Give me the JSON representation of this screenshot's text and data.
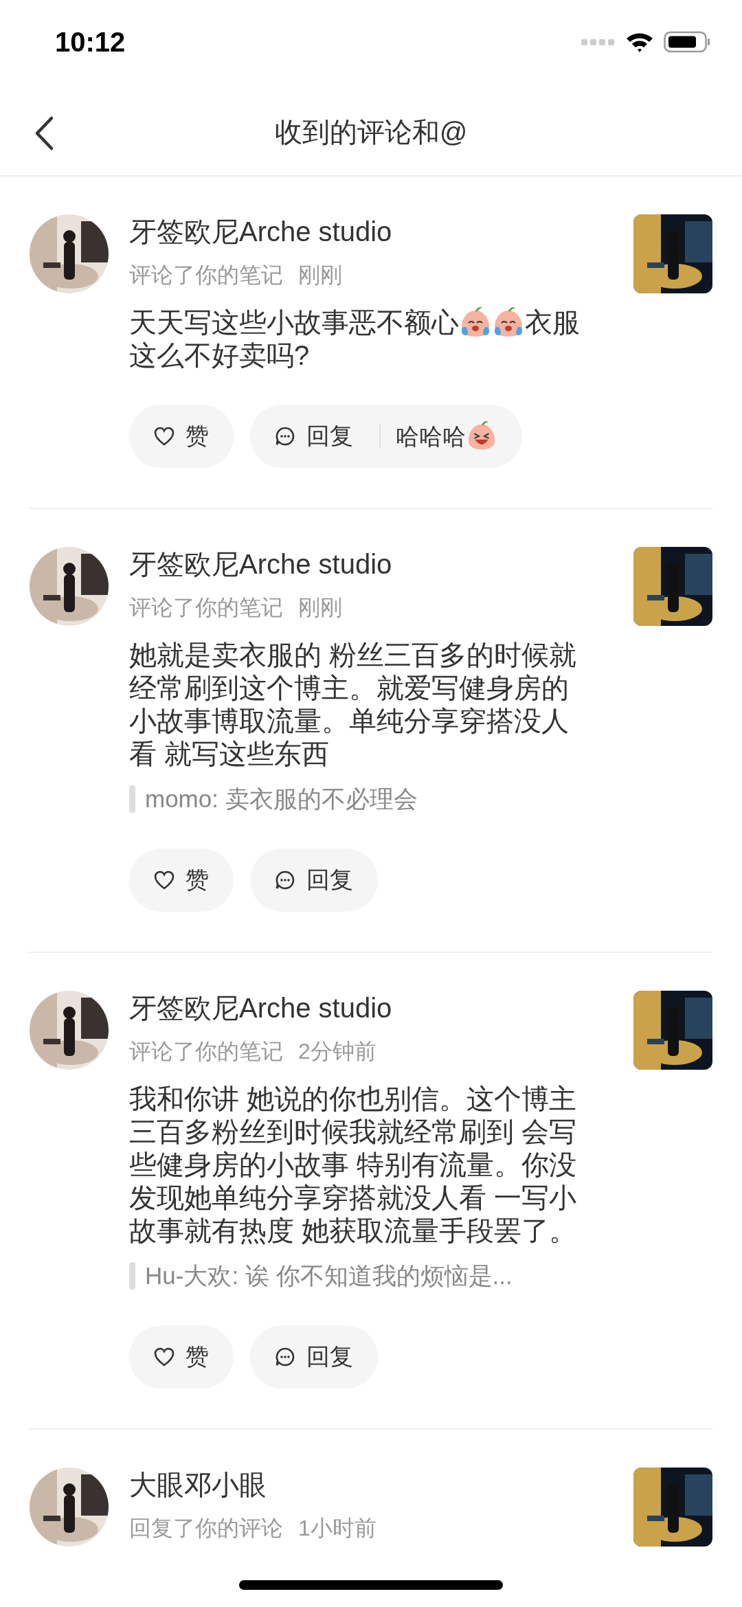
{
  "status_bar": {
    "time": "10:12"
  },
  "nav": {
    "title": "收到的评论和@"
  },
  "comments": [
    {
      "user": "牙签欧尼Arche studio",
      "action": "评论了你的笔记",
      "time": "刚刚",
      "body": [
        {
          "kind": "text",
          "text": "天天写这些小故事恶不额心"
        },
        {
          "kind": "tearful"
        },
        {
          "kind": "tearful"
        },
        {
          "kind": "text",
          "text": "衣服这么不好卖吗?"
        }
      ],
      "like": "赞",
      "reply": "回复",
      "quick_reply": [
        {
          "kind": "text",
          "text": "哈哈哈"
        },
        {
          "kind": "grinning"
        }
      ]
    },
    {
      "user": "牙签欧尼Arche studio",
      "action": "评论了你的笔记",
      "time": "刚刚",
      "body": [
        {
          "kind": "text",
          "text": "她就是卖衣服的 粉丝三百多的时候就经常刷到这个博主。就爱写健身房的小故事博取流量。单纯分享穿搭没人看 就写这些东西"
        }
      ],
      "quote": "momo: 卖衣服的不必理会",
      "like": "赞",
      "reply": "回复"
    },
    {
      "user": "牙签欧尼Arche studio",
      "action": "评论了你的笔记",
      "time": "2分钟前",
      "body": [
        {
          "kind": "text",
          "text": "我和你讲 她说的你也别信。这个博主三百多粉丝到时候我就经常刷到 会写些健身房的小故事 特别有流量。你没发现她单纯分享穿搭就没人看 一写小故事就有热度 她获取流量手段罢了。"
        }
      ],
      "quote": "Hu-大欢: 诶 你不知道我的烦恼是...",
      "like": "赞",
      "reply": "回复"
    },
    {
      "user": "大眼邓小眼",
      "action": "回复了你的评论",
      "time": "1小时前"
    }
  ]
}
